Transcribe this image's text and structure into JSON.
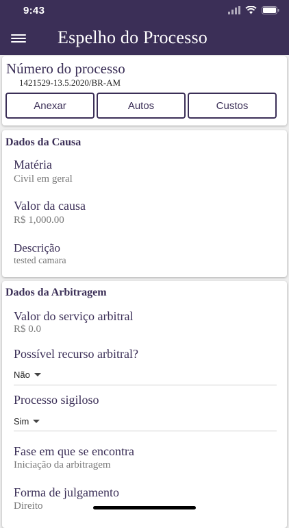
{
  "status_bar": {
    "time": "9:43"
  },
  "app_bar": {
    "title": "Espelho do Processo"
  },
  "process": {
    "label": "Número do processo",
    "number": "1421529-13.5.2020/BR-AM"
  },
  "actions": {
    "anexar": "Anexar",
    "autos": "Autos",
    "custos": "Custos"
  },
  "dados_causa": {
    "title": "Dados da Causa",
    "materia_label": "Matéria",
    "materia_value": "Civil em geral",
    "valor_label": "Valor da causa",
    "valor_value": "R$ 1,000.00",
    "descricao_label": "Descrição",
    "descricao_value": "tested camara"
  },
  "dados_arbitragem": {
    "title": "Dados da Arbitragem",
    "valor_servico_label": "Valor do serviço arbitral",
    "valor_servico_value": "R$ 0.0",
    "recurso_label": "Possível recurso arbitral?",
    "recurso_value": "Não",
    "sigiloso_label": "Processo sigiloso",
    "sigiloso_value": "Sim",
    "fase_label": "Fase em que se encontra",
    "fase_value": "Iniciação da arbitragem",
    "forma_label": "Forma de julgamento",
    "forma_value": "Direito"
  },
  "colors": {
    "primary": "#3b2f57",
    "background": "#eeeeee"
  },
  "icons": [
    "menu-icon",
    "signal-icon",
    "wifi-icon",
    "battery-icon",
    "dropdown-caret-icon"
  ]
}
